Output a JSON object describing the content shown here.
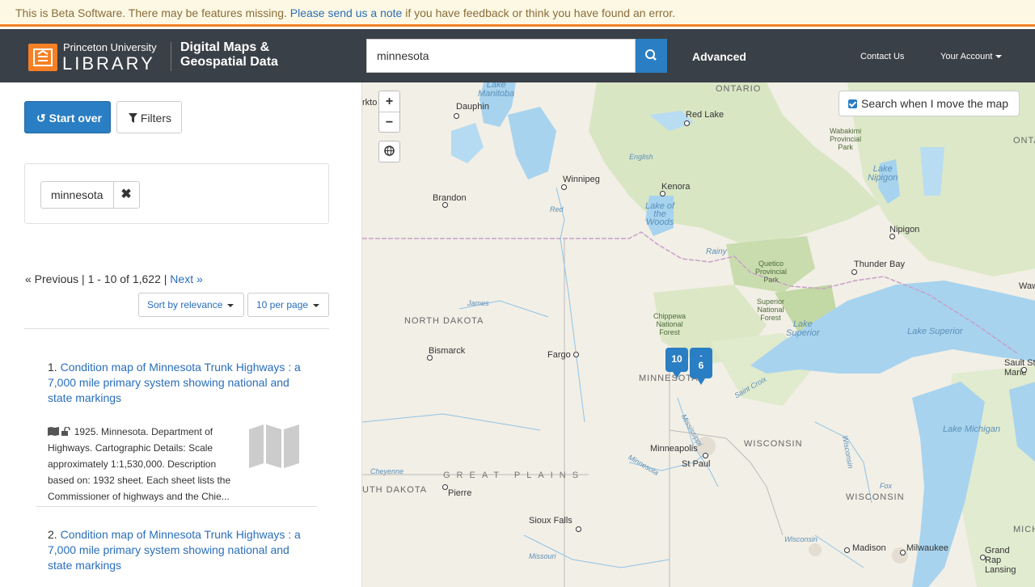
{
  "banner": {
    "text": "This is Beta Software. There may be features missing.",
    "link": "Please send us a note",
    "suffix": "if you have feedback or think you have found an error."
  },
  "header": {
    "org_line1": "Princeton University",
    "org_line2": "LIBRARY",
    "app_line1": "Digital Maps &",
    "app_line2": "Geospatial Data",
    "search_value": "minnesota",
    "advanced": "Advanced",
    "contact": "Contact Us",
    "account": "Your Account"
  },
  "sidebar": {
    "start_over": "Start over",
    "filters": "Filters",
    "constraint": "minnesota",
    "pager": {
      "previous": "« Previous",
      "range": "1 - 10 of 1,622",
      "next": "Next »"
    },
    "sort": "Sort by relevance",
    "per_page": "10 per page",
    "results": [
      {
        "number": "1.",
        "title": "Condition map of Minnesota Trunk Highways : a 7,000 mile primary system showing national and state markings",
        "description": "1925. Minnesota. Department of Highways. Cartographic Details: Scale approximately 1:1,530,000. Description based on: 1932 sheet. Each sheet lists the Commissioner of highways and the Chie..."
      },
      {
        "number": "2.",
        "title": "Condition map of Minnesota Trunk Highways : a 7,000 mile primary system showing national and state markings",
        "description": ""
      }
    ]
  },
  "map": {
    "zoom_in": "+",
    "zoom_out": "−",
    "search_when_move": "Search when I move the map",
    "markers": [
      "10",
      "6"
    ],
    "marker_2_top": "-",
    "labels": {
      "lake_manitoba": "Lake\nManitoba",
      "dauphin": "Dauphin",
      "ontario": "ONTARIO",
      "ontario2": "ONTAR",
      "red_lake": "Red Lake",
      "wabakimi": "Wabakimi\nProvincial\nPark",
      "lake_nipigon": "Lake\nNipigon",
      "winnipeg": "Winnipeg",
      "winnipeg_r": "Winnipeg",
      "english": "English",
      "kenora": "Kenora",
      "brandon": "Brandon",
      "lake_woods": "Lake of\nthe\nWoods",
      "red": "Red",
      "nipigon": "Nipigon",
      "rainy": "Rainy",
      "quetico": "Quetico\nProvincial\nPark",
      "thunder_bay": "Thunder Bay",
      "waw": "Waw",
      "james": "James",
      "north_dakota": "NORTH DAKOTA",
      "chippewa": "Chippewa\nNational\nForest",
      "superior_nf": "Superior\nNational\nForest",
      "lake_superior": "Lake\nSuperior",
      "lake_superior2": "Lake Superior",
      "bismarck": "Bismarck",
      "fargo": "Fargo",
      "minnesota": "MINNESOTA",
      "sault": "Sault Ste\nMarie",
      "st_croix": "Saint Croix",
      "mississippi": "Mississippi",
      "wisconsin_state": "WISCONSIN",
      "wisconsin_r": "Wisconsin",
      "lake_michigan": "Lake Michigan",
      "minneapolis": "Minneapolis",
      "st_paul": "St Paul",
      "cheyenne": "Cheyenne",
      "great_plains": "GREAT PLAINS",
      "minnesota_r": "Minnesota",
      "south_dakota": "UTH DAKOTA",
      "pierre": "Pierre",
      "fox": "Fox",
      "wisconsin2": "WISCONSIN",
      "michig": "MICHIG",
      "sioux_falls": "Sioux Falls",
      "wisconsin_r2": "Wisconsin",
      "madison": "Madison",
      "milwaukee": "Milwaukee",
      "grand_rap": "Grand\nRap",
      "missouri": "Missouri",
      "lansing": "Lansing",
      "rkto": "rkto"
    }
  }
}
